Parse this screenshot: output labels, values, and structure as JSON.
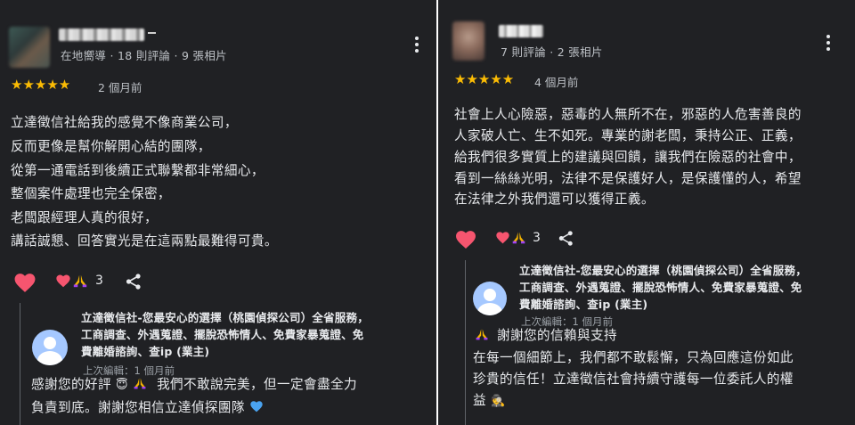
{
  "left": {
    "reviewer_meta": "在地嚮導 · 18 則評論 · 9 張相片",
    "rating": "★★★★★",
    "time_ago": "2 個月前",
    "review_lines": [
      "立達徵信社給我的感覺不像商業公司，",
      "反而更像是幫你解開心結的團隊，",
      "從第一通電話到後續正式聯繫都非常細心，",
      "整個案件處理也完全保密，",
      "老闆跟經理人真的很好，",
      "講話誠懇、回答實光是在這兩點最難得可貴。"
    ],
    "reaction_count": "3",
    "owner": {
      "name_lines": [
        "立達徵信社-您最安心的選擇（桃園偵探公司）全省服務，",
        "工商調查、外遇蒐證、擺脫恐怖情人、免費家暴蒐證、免",
        "費離婚諮詢、查ip (業主)"
      ],
      "edited": "上次編輯：1 個月前",
      "reply_lines": [
        "感謝您的好評",
        "我們不敢說完美，但一定會盡全力",
        "負責到底。謝謝您相信立達偵探團隊"
      ]
    }
  },
  "right": {
    "reviewer_meta": "7 則評論 · 2 張相片",
    "rating": "★★★★★",
    "time_ago": "4 個月前",
    "review_lines": [
      "社會上人心險惡，惡毒的人無所不在，邪惡的人危害善良的",
      "人家破人亡、生不如死。專業的謝老闆，秉持公正、正義，",
      "給我們很多實質上的建議與回饋，讓我們在險惡的社會中，",
      "看到一絲絲光明，法律不是保護好人，是保護懂的人，希望",
      "在法律之外我們還可以獲得正義。"
    ],
    "reaction_count": "3",
    "owner": {
      "name_lines": [
        "立達徵信社-您最安心的選擇（桃園偵探公司）全省服務，",
        "工商調查、外遇蒐證、擺脫恐怖情人、免費家暴蒐證、免",
        "費離婚諮詢、查ip (業主)"
      ],
      "edited": "上次編輯：1 個月前",
      "reply_lines": [
        "謝謝您的信賴與支持",
        "在每一個細節上，我們都不敢鬆懈，只為回應這份如此",
        "珍貴的信任！立達徵信社會持續守護每一位委託人的權",
        "益"
      ]
    }
  },
  "colors": {
    "card_bg": "#202124",
    "star": "#fbbc04",
    "heart": "#f6556f",
    "owner_avatar": "#a5c8ff"
  },
  "icons": [
    "more-vert-icon",
    "heart-icon",
    "pray-hands-icon",
    "share-icon",
    "person-icon"
  ]
}
